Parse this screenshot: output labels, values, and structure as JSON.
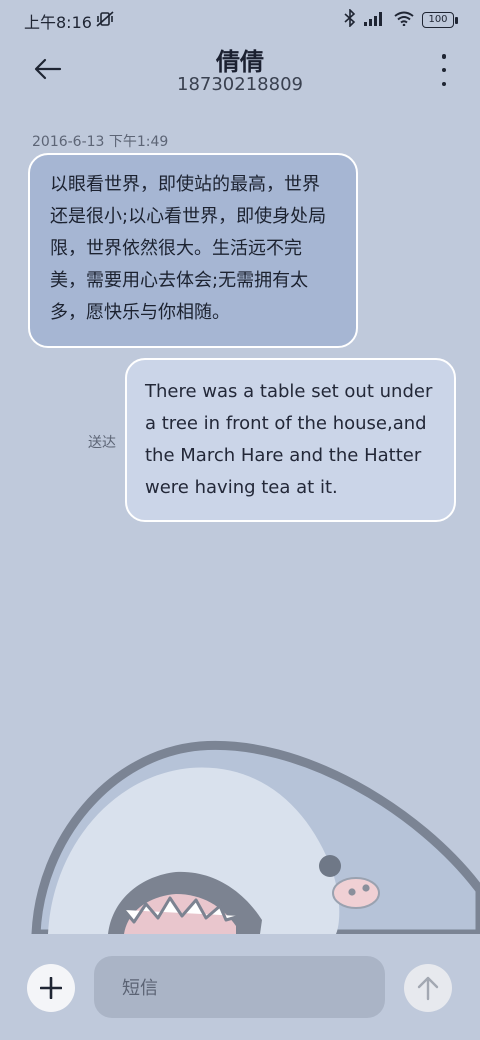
{
  "status": {
    "time": "上午8:16",
    "battery": "100"
  },
  "header": {
    "contact_name": "倩倩",
    "phone_number": "18730218809"
  },
  "messages": {
    "timestamp": "2016-6-13 下午1:49",
    "incoming_text": "以眼看世界，即使站的最高，世界还是很小;以心看世界，即使身处局限，世界依然很大。生活远不完美，需要用心去体会;无需拥有太多，愿快乐与你相随。",
    "outgoing_text": "There was a table set out under a tree in front of the house,and the March Hare and the Hatter were having tea at it.",
    "delivered_label": "送达"
  },
  "composer": {
    "placeholder": "短信"
  },
  "icons": [
    "back-arrow-icon",
    "more-icon",
    "plus-icon",
    "send-arrow-icon",
    "bluetooth-icon",
    "signal-icon",
    "wifi-icon",
    "battery-icon",
    "vibrate-off-icon"
  ],
  "colors": {
    "background": "#bfc9db",
    "incoming_bubble": "#a6b6d3",
    "outgoing_bubble": "#cbd5e8"
  }
}
